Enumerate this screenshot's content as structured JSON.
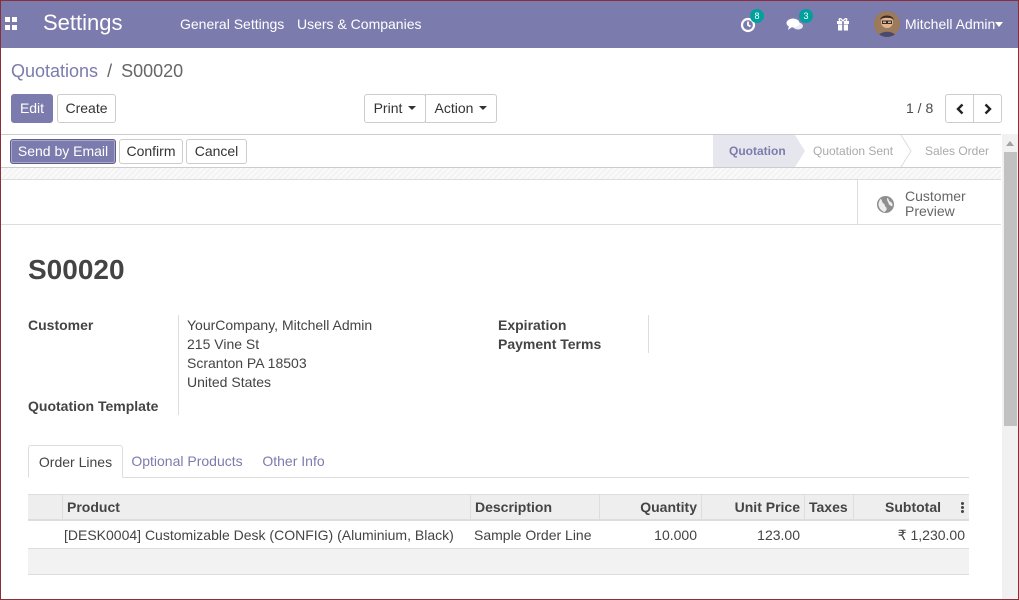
{
  "navbar": {
    "brand": "Settings",
    "menu": [
      "General Settings",
      "Users & Companies"
    ],
    "activity_count": "8",
    "message_count": "3",
    "user_name": "Mitchell Admin",
    "bg_color": "#7c7bad",
    "icons": [
      "apps-icon",
      "activity-clock-icon",
      "messages-chat-icon",
      "gift-icon",
      "chevron-down-icon"
    ]
  },
  "breadcrumb": {
    "parent": "Quotations",
    "separator": "/",
    "current": "S00020"
  },
  "control_panel": {
    "edit_label": "Edit",
    "create_label": "Create",
    "print_label": "Print",
    "action_label": "Action",
    "pager_value": "1 / 8"
  },
  "statusbar": {
    "buttons": [
      "Send by Email",
      "Confirm",
      "Cancel"
    ],
    "stages": [
      "Quotation",
      "Quotation Sent",
      "Sales Order"
    ],
    "active_stage": "Quotation"
  },
  "button_box": {
    "customer_preview_line1": "Customer",
    "customer_preview_line2": "Preview"
  },
  "record": {
    "title": "S00020",
    "customer_label": "Customer",
    "customer_name": "YourCompany, Mitchell Admin",
    "address": [
      "215 Vine St",
      "Scranton PA 18503",
      "United States"
    ],
    "quotation_template_label": "Quotation Template",
    "expiration_label": "Expiration",
    "payment_terms_label": "Payment Terms"
  },
  "tabs": [
    {
      "label": "Order Lines",
      "active": true
    },
    {
      "label": "Optional Products",
      "active": false
    },
    {
      "label": "Other Info",
      "active": false
    }
  ],
  "order_lines": {
    "columns": [
      "Product",
      "Description",
      "Quantity",
      "Unit Price",
      "Taxes",
      "Subtotal"
    ],
    "rows": [
      {
        "product": "[DESK0004] Customizable Desk (CONFIG) (Aluminium, Black)",
        "description": "Sample Order Line",
        "quantity": "10.000",
        "unit_price": "123.00",
        "taxes": "",
        "subtotal": "₹ 1,230.00"
      }
    ]
  }
}
